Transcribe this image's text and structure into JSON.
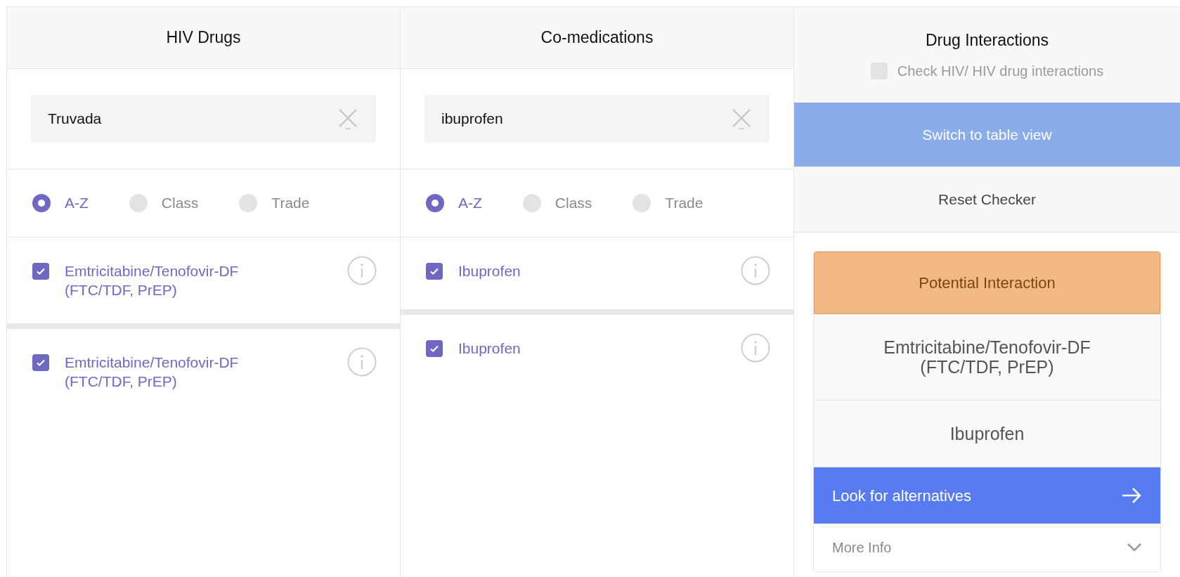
{
  "columns": [
    {
      "title": "HIV Drugs",
      "search": {
        "value": "Truvada"
      },
      "sort_options": [
        {
          "label": "A-Z",
          "selected": true
        },
        {
          "label": "Class",
          "selected": false
        },
        {
          "label": "Trade",
          "selected": false
        }
      ],
      "items": [
        {
          "label": "Emtricitabine/Tenofovir-DF (FTC/TDF, PrEP)",
          "checked": true
        },
        {
          "label": "Emtricitabine/Tenofovir-DF (FTC/TDF, PrEP)",
          "checked": true
        }
      ]
    },
    {
      "title": "Co-medications",
      "search": {
        "value": "ibuprofen"
      },
      "sort_options": [
        {
          "label": "A-Z",
          "selected": true
        },
        {
          "label": "Class",
          "selected": false
        },
        {
          "label": "Trade",
          "selected": false
        }
      ],
      "items": [
        {
          "label": "Ibuprofen",
          "checked": true
        },
        {
          "label": "Ibuprofen",
          "checked": true
        }
      ]
    }
  ],
  "interactions": {
    "title": "Drug Interactions",
    "hiv_check": {
      "label": "Check HIV/ HIV drug interactions",
      "checked": false
    },
    "buttons": [
      "Switch to table view",
      "Reset Checker"
    ],
    "result": {
      "status": "Potential Interaction",
      "drugs": [
        "Emtricitabine/Tenofovir-DF (FTC/TDF, PrEP)",
        "Ibuprofen"
      ],
      "action": "Look for alternatives",
      "more": "More Info",
      "expanded": false
    }
  }
}
